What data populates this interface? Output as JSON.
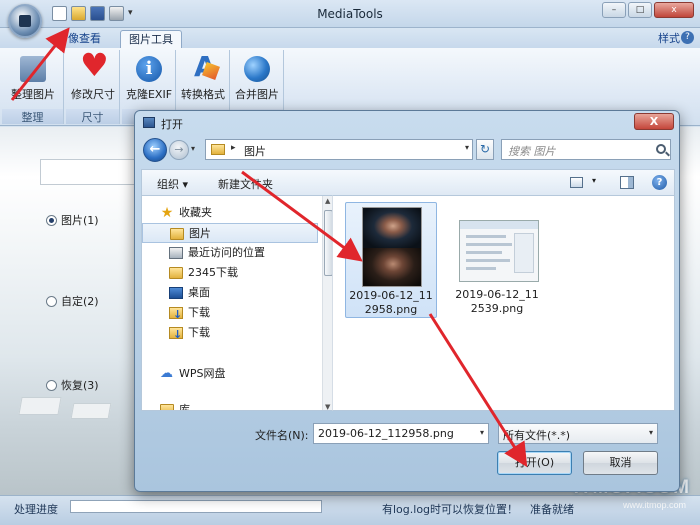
{
  "app": {
    "title": "MediaTools",
    "tabs": [
      {
        "label": "像查看"
      },
      {
        "label": "图片工具"
      }
    ],
    "style_menu": "样式",
    "ribbon": {
      "groups": [
        {
          "caption": "整理",
          "buttons": [
            {
              "label": "整理图片",
              "icon": "sort-images-icon"
            }
          ]
        },
        {
          "caption": "尺寸",
          "buttons": [
            {
              "label": "修改尺寸",
              "icon": "heart-icon"
            }
          ]
        },
        {
          "caption": "",
          "buttons": [
            {
              "label": "克隆EXIF",
              "icon": "info-icon"
            }
          ]
        },
        {
          "caption": "",
          "buttons": [
            {
              "label": "转换格式",
              "icon": "convert-icon"
            }
          ]
        },
        {
          "caption": "",
          "buttons": [
            {
              "label": "合并图片",
              "icon": "globe-icon"
            }
          ]
        }
      ]
    },
    "radios": [
      {
        "label": "图片(1)",
        "checked": true
      },
      {
        "label": "自定(2)",
        "checked": false
      },
      {
        "label": "恢复(3)",
        "checked": false
      }
    ],
    "status": {
      "label": "处理进度",
      "message": "有log.log时可以恢复位置！",
      "ready": "准备就绪"
    },
    "watermark": {
      "logo": "ITMOP.COM",
      "site": "www.itmop.com"
    }
  },
  "dialog": {
    "title": "打开",
    "close": "X",
    "address": {
      "path": "图片"
    },
    "search": {
      "placeholder": "搜索 图片"
    },
    "toolbar": {
      "organize": "组织 ▾",
      "new_folder": "新建文件夹"
    },
    "nav": {
      "favorites": "收藏夹",
      "items": [
        {
          "label": "图片",
          "icon": "folder-icon",
          "selected": true
        },
        {
          "label": "最近访问的位置",
          "icon": "recent-places-icon",
          "selected": false
        },
        {
          "label": "2345下载",
          "icon": "folder-icon",
          "selected": false
        },
        {
          "label": "桌面",
          "icon": "desktop-icon",
          "selected": false
        },
        {
          "label": "下载",
          "icon": "download-folder-icon",
          "selected": false
        },
        {
          "label": "下载",
          "icon": "download-folder-icon",
          "selected": false
        }
      ],
      "wps": "WPS网盘",
      "partial": "库"
    },
    "files": [
      {
        "name": "2019-06-12_112958.png",
        "selected": true
      },
      {
        "name": "2019-06-12_112539.png",
        "selected": false
      }
    ],
    "filename": {
      "label": "文件名(N):",
      "value": "2019-06-12_112958.png"
    },
    "filetype": {
      "value": "所有文件(*.*)"
    },
    "buttons": {
      "open": "打开(O)",
      "cancel": "取消"
    }
  },
  "colors": {
    "annotation_arrow": "#e0262c",
    "accent": "#3d70b3"
  }
}
